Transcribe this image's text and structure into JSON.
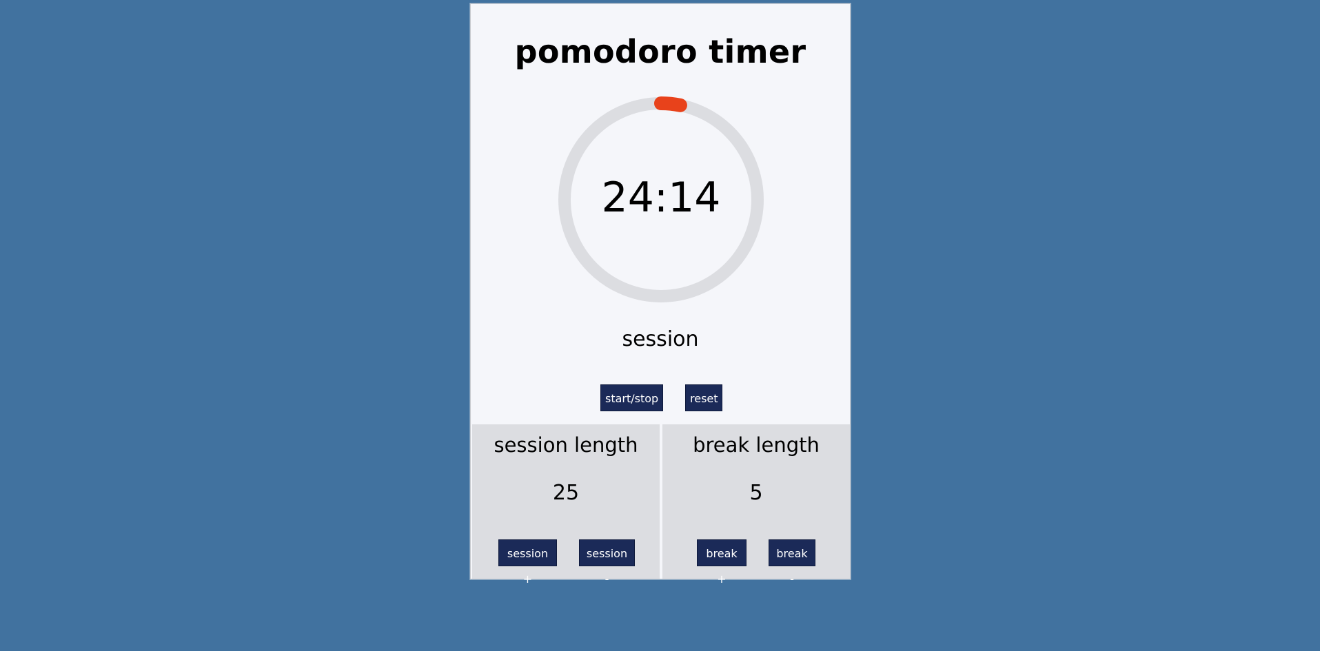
{
  "app": {
    "title": "pomodoro timer"
  },
  "timer": {
    "display": "24:14",
    "mode_label": "session",
    "progress_fraction": 0.032,
    "track_color": "#dcdde1",
    "progress_color": "#e8421b"
  },
  "controls": {
    "start_stop_label": "start/stop",
    "reset_label": "reset"
  },
  "session": {
    "title": "session length",
    "value": "25",
    "increment_label": "session +",
    "decrement_label": "session -"
  },
  "break": {
    "title": "break length",
    "value": "5",
    "increment_label": "break +",
    "decrement_label": "break -"
  },
  "colors": {
    "background": "#41729f",
    "card": "#f5f6fa",
    "panel": "#dcdde1",
    "button": "#1b2a58",
    "accent": "#e8421b"
  }
}
